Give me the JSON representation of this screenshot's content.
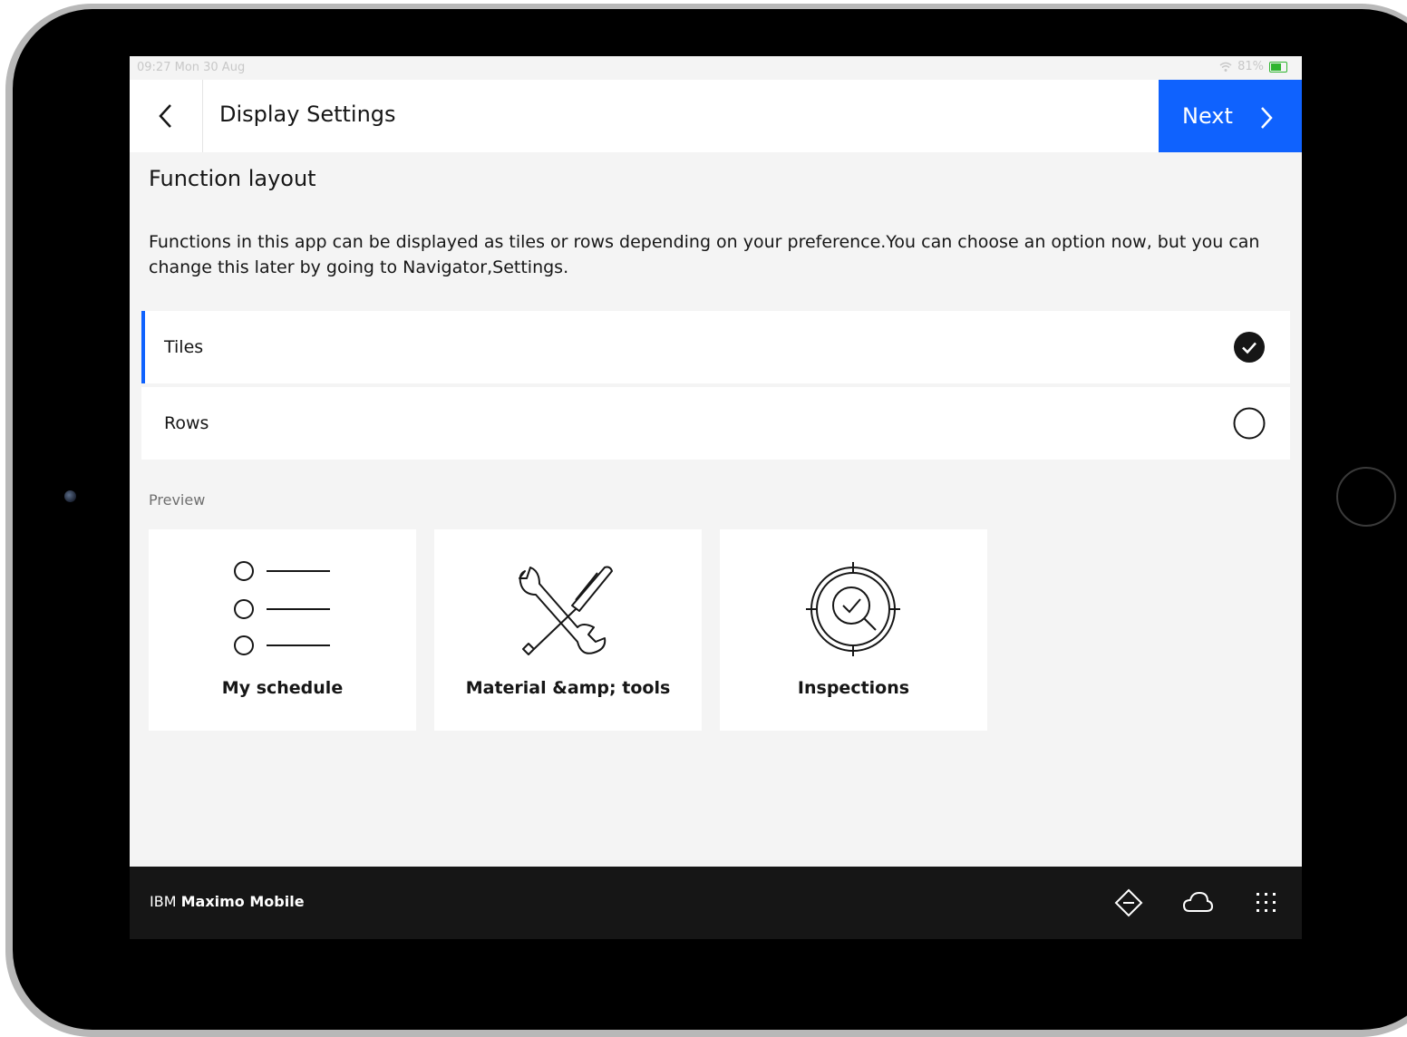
{
  "status_bar": {
    "time": "09:27  Mon 30 Aug",
    "battery": "81%"
  },
  "header": {
    "title": "Display Settings",
    "next_label": "Next"
  },
  "content": {
    "section_title": "Function layout",
    "description": "Functions in this app can be displayed as tiles or rows depending on your preference.You can choose an option now, but you can change this later by going to Navigator,Settings.",
    "options": [
      {
        "label": "Tiles",
        "selected": true
      },
      {
        "label": "Rows",
        "selected": false
      }
    ],
    "preview_label": "Preview",
    "tiles": [
      {
        "label": "My schedule",
        "icon": "list-icon"
      },
      {
        "label": "Material &amp; tools",
        "icon": "tools-icon"
      },
      {
        "label": "Inspections",
        "icon": "inspection-icon"
      }
    ]
  },
  "footer": {
    "brand_prefix": "IBM",
    "brand_name": "Maximo Mobile",
    "icons": [
      "navigation-icon",
      "cloud-icon",
      "app-grid-icon"
    ]
  },
  "colors": {
    "accent": "#0f62fe",
    "footer_bg": "#161616",
    "page_bg": "#f4f4f4"
  }
}
